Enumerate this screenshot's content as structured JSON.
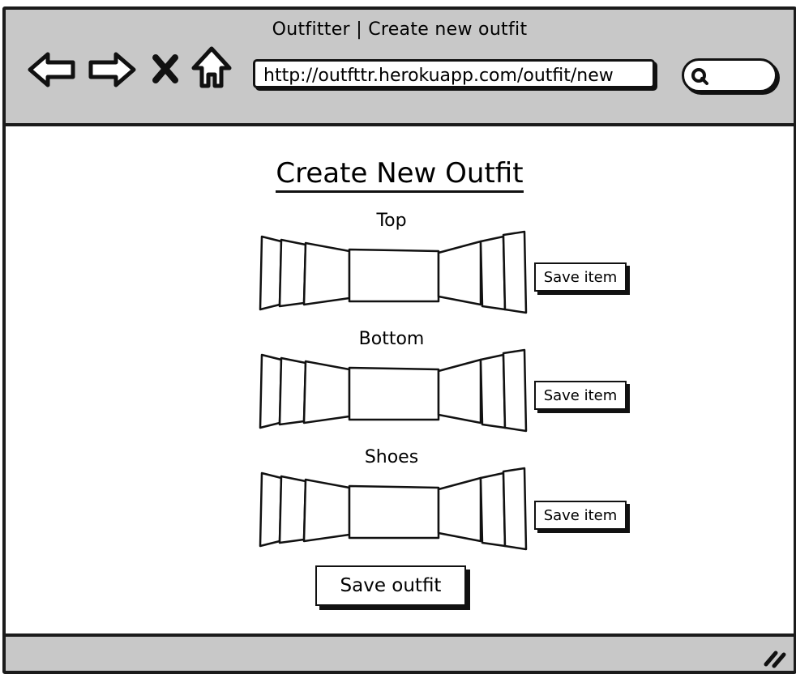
{
  "window": {
    "title": "Outfitter  |  Create new outfit"
  },
  "browser": {
    "url": "http://outfttr.herokuapp.com/outfit/new",
    "nav_icons": [
      "back-arrow-icon",
      "forward-arrow-icon",
      "stop-icon",
      "home-icon"
    ],
    "search_icon": "search-icon"
  },
  "page": {
    "title": "Create New Outfit",
    "sections": [
      {
        "label": "Top",
        "button": "Save item"
      },
      {
        "label": "Bottom",
        "button": "Save item"
      },
      {
        "label": "Shoes",
        "button": "Save item"
      }
    ],
    "save_outfit": "Save outfit"
  },
  "colors": {
    "chrome": "#c8c8c8",
    "ink": "#111111",
    "background": "#ffffff"
  }
}
